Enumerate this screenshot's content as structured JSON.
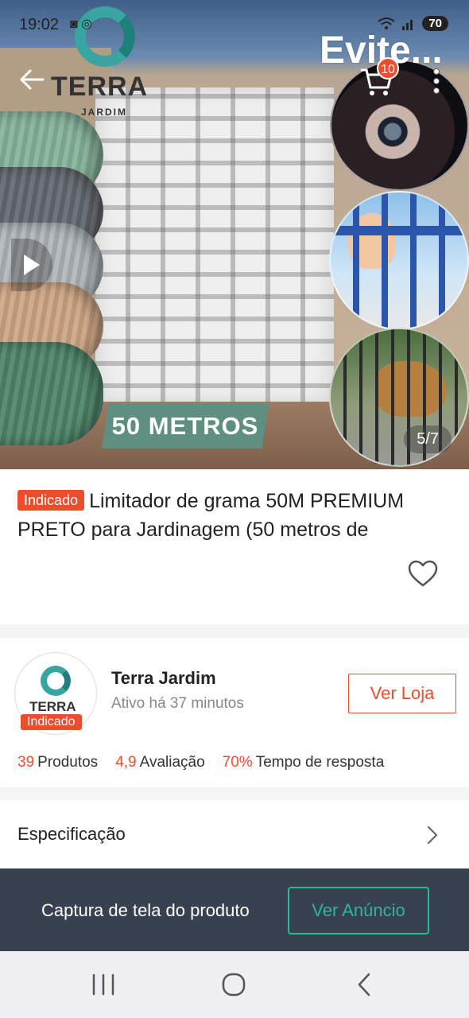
{
  "status_bar": {
    "time": "19:02",
    "icons": "◙ ◎",
    "battery": "70"
  },
  "hero": {
    "brand_name": "TERRA",
    "brand_sub": "JARDIM",
    "overlay_text": "Evite...",
    "banner_text": "50 METROS",
    "cart_count": "10",
    "page_indicator": "5/7"
  },
  "product": {
    "tag": "Indicado",
    "title": "Limitador de grama 50M PREMIUM PRETO para Jardinagem (50 metros de"
  },
  "store": {
    "avatar_word": "TERRA",
    "tag": "Indicado",
    "name": "Terra Jardim",
    "active": "Ativo há 37 minutos",
    "visit_label": "Ver Loja",
    "stats": [
      {
        "value": "39",
        "label": "Produtos"
      },
      {
        "value": "4,9",
        "label": "Avaliação"
      },
      {
        "value": "70%",
        "label": "Tempo de resposta"
      }
    ]
  },
  "spec": {
    "label": "Especificação"
  },
  "capture": {
    "text": "Captura de tela do produto",
    "button": "Ver Anúncio"
  },
  "colors": {
    "accent": "#ee4d2d",
    "teal": "#2fb59a",
    "bar_bg": "#38414f"
  },
  "icons": [
    "back-arrow-icon",
    "cart-icon",
    "more-vert-icon",
    "play-icon",
    "heart-icon",
    "chevron-right-icon",
    "nav-recent-icon",
    "nav-home-icon",
    "nav-back-icon"
  ]
}
